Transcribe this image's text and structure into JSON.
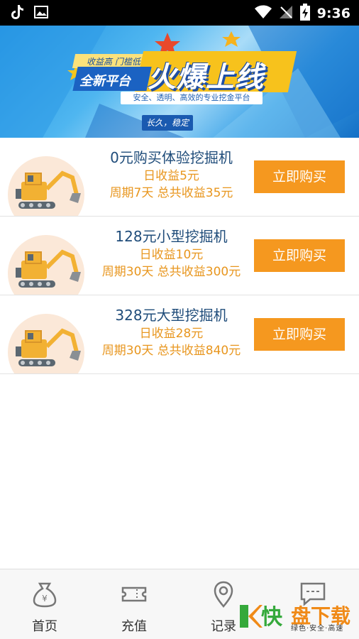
{
  "status_bar": {
    "time": "9:36",
    "left_icons": [
      "tiktok-icon",
      "image-icon"
    ],
    "right_icons": [
      "wifi-icon",
      "signal-off-icon",
      "battery-charging-icon"
    ]
  },
  "banner": {
    "small_tag": "收益高 门槛低",
    "subhead": "全新平台",
    "headline": "火爆上线",
    "tagline": "安全、透明、高效的专业挖金平台",
    "slogan": "长久，稳定"
  },
  "products": [
    {
      "title": "0元购买体验挖掘机",
      "daily": "日收益5元",
      "period": "周期7天 总共收益35元",
      "buy_label": "立即购买"
    },
    {
      "title": "128元小型挖掘机",
      "daily": "日收益10元",
      "period": "周期30天 总共收益300元",
      "buy_label": "立即购买"
    },
    {
      "title": "328元大型挖掘机",
      "daily": "日收益28元",
      "period": "周期30天 总共收益840元",
      "buy_label": "立即购买"
    }
  ],
  "tabs": [
    {
      "label": "首页",
      "icon": "money-bag-icon"
    },
    {
      "label": "充值",
      "icon": "ticket-icon"
    },
    {
      "label": "记录",
      "icon": "location-pin-icon"
    },
    {
      "label": "",
      "icon": "chat-bubble-icon"
    }
  ],
  "watermark": {
    "kuai": "快",
    "rest": "盘下载",
    "sub": "绿色·安全·高速"
  },
  "colors": {
    "accent_orange": "#f5981f",
    "title_blue": "#1f4c7a",
    "income_orange": "#e8961e"
  }
}
